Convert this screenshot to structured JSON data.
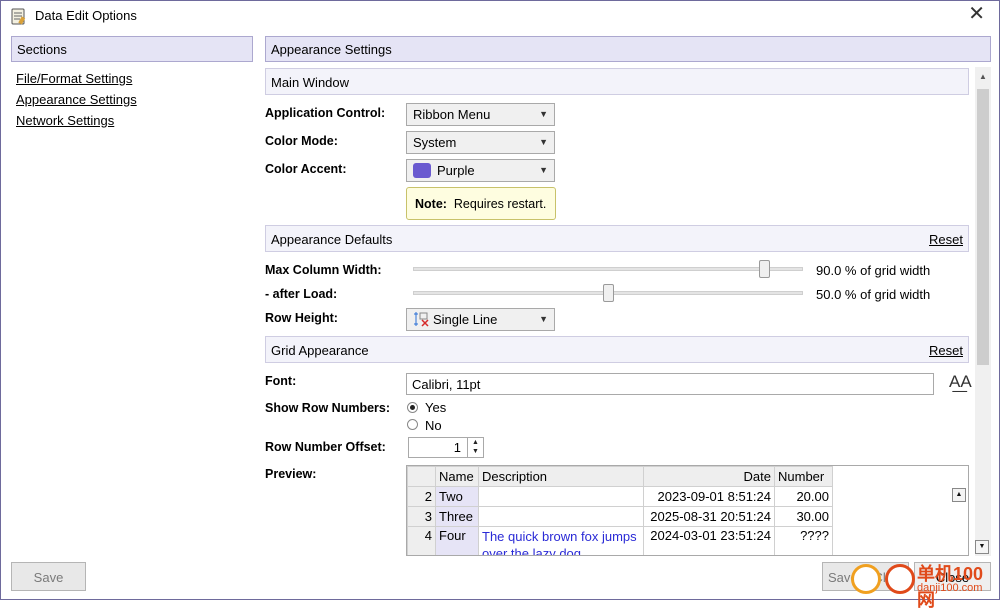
{
  "window": {
    "title": "Data Edit Options"
  },
  "sidebar": {
    "header": "Sections",
    "items": [
      {
        "label": "File/Format Settings"
      },
      {
        "label": "Appearance Settings"
      },
      {
        "label": "Network Settings"
      }
    ]
  },
  "main": {
    "header": "Appearance Settings",
    "main_window": {
      "title": "Main Window",
      "application_control": {
        "label": "Application Control:",
        "value": "Ribbon Menu"
      },
      "color_mode": {
        "label": "Color Mode:",
        "value": "System"
      },
      "color_accent": {
        "label": "Color Accent:",
        "value": "Purple",
        "swatch_color": "#6a5ad0"
      },
      "note": {
        "bold": "Note:",
        "text": "Requires restart."
      }
    },
    "appearance_defaults": {
      "title": "Appearance Defaults",
      "reset": "Reset",
      "max_column_width": {
        "label": "Max Column Width:",
        "value_text": "90.0 % of grid width",
        "value": 0.9
      },
      "after_load": {
        "label": "- after Load:",
        "value_text": "50.0 % of grid width",
        "value": 0.5
      },
      "row_height": {
        "label": "Row Height:",
        "value": "Single Line"
      }
    },
    "grid_appearance": {
      "title": "Grid Appearance",
      "reset": "Reset",
      "font": {
        "label": "Font:",
        "value": "Calibri, 11pt"
      },
      "show_row_numbers": {
        "label": "Show Row Numbers:",
        "options": [
          "Yes",
          "No"
        ],
        "selected": "Yes"
      },
      "row_number_offset": {
        "label": "Row Number Offset:",
        "value": "1"
      },
      "preview": {
        "label": "Preview:",
        "columns": [
          "Name",
          "Description",
          "Date",
          "Number"
        ],
        "rows": [
          {
            "num": "2",
            "name": "Two",
            "description": "",
            "date": "2023-09-01 8:51:24",
            "number": "20.00"
          },
          {
            "num": "3",
            "name": "Three",
            "description": "",
            "date": "2025-08-31 20:51:24",
            "number": "30.00"
          },
          {
            "num": "4",
            "name": "Four",
            "description": "The quick brown fox jumps over the lazy dog",
            "date": "2024-03-01 23:51:24",
            "number": "????"
          }
        ]
      }
    }
  },
  "footer": {
    "save_left": "Save",
    "save_right": "Save & Close",
    "close": "Close"
  },
  "watermark": {
    "line1": "单机100网",
    "line2": "danji100.com"
  },
  "colors": {
    "accent": "#e5e4f5",
    "border": "#aca8cf",
    "link_blue": "#2a2ad6"
  }
}
